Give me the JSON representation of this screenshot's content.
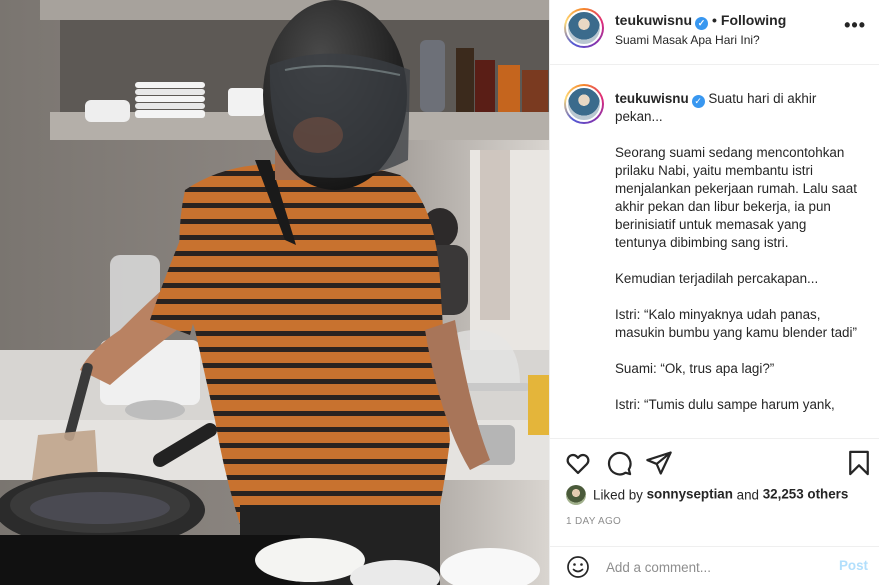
{
  "header": {
    "username": "teukuwisnu",
    "verified_mark": "✓",
    "separator": "•",
    "follow_status": "Following",
    "subtitle": "Suami Masak Apa Hari Ini?",
    "more_icon": "more-horizontal-icon",
    "more_label": "•••"
  },
  "caption": {
    "username": "teukuwisnu",
    "verified_mark": "✓",
    "text": " Suatu hari di akhir pekan...\n\nSeorang suami sedang mencontohkan prilaku Nabi, yaitu membantu istri menjalankan pekerjaan rumah. Lalu saat akhir pekan dan libur bekerja, ia pun berinisiatif untuk memasak yang tentunya dibimbing sang istri.\n\nKemudian terjadilah percakapan...\n\nIstri: “Kalo minyaknya udah panas, masukin bumbu yang kamu blender tadi”\n\nSuami: “Ok, trus apa lagi?”\n\nIstri: “Tumis dulu sampe harum yank,"
  },
  "actions": {
    "icons": [
      "heart-icon",
      "comment-icon",
      "share-icon",
      "bookmark-icon"
    ]
  },
  "likes": {
    "prefix": "Liked by ",
    "user": "sonnyseptian",
    "middle": " and ",
    "count": "32,253 others"
  },
  "date": "1 DAY AGO",
  "comment": {
    "placeholder": "Add a comment...",
    "post_label": "Post",
    "emoji_icon": "smiley-icon"
  },
  "colors": {
    "verified": "#3897f0",
    "post_disabled": "#b2dffc",
    "muted": "#8e8e8e",
    "text": "#262626"
  }
}
